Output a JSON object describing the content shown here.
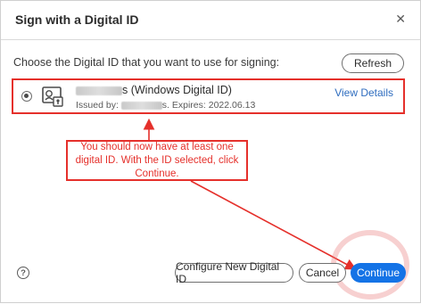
{
  "dialog": {
    "title": "Sign with a Digital ID",
    "close_glyph": "✕"
  },
  "prompt": "Choose the Digital ID that you want to use for signing:",
  "refresh_label": "Refresh",
  "digital_id": {
    "name_suffix": "s (Windows Digital ID)",
    "issued_prefix": "Issued by:",
    "issued_suffix": "s. Expires: 2022.06.13",
    "view_details_label": "View Details",
    "selected": true
  },
  "annotation": {
    "callout_text": "You should now have at least one digital ID. With the ID selected, click Continue.",
    "color": "#e5302b"
  },
  "footer": {
    "help_glyph": "?",
    "configure_label": "Configure New Digital ID",
    "cancel_label": "Cancel",
    "continue_label": "Continue"
  },
  "colors": {
    "accent": "#1473e6",
    "link": "#2f6dbf",
    "annotation_red": "#e5302b"
  }
}
